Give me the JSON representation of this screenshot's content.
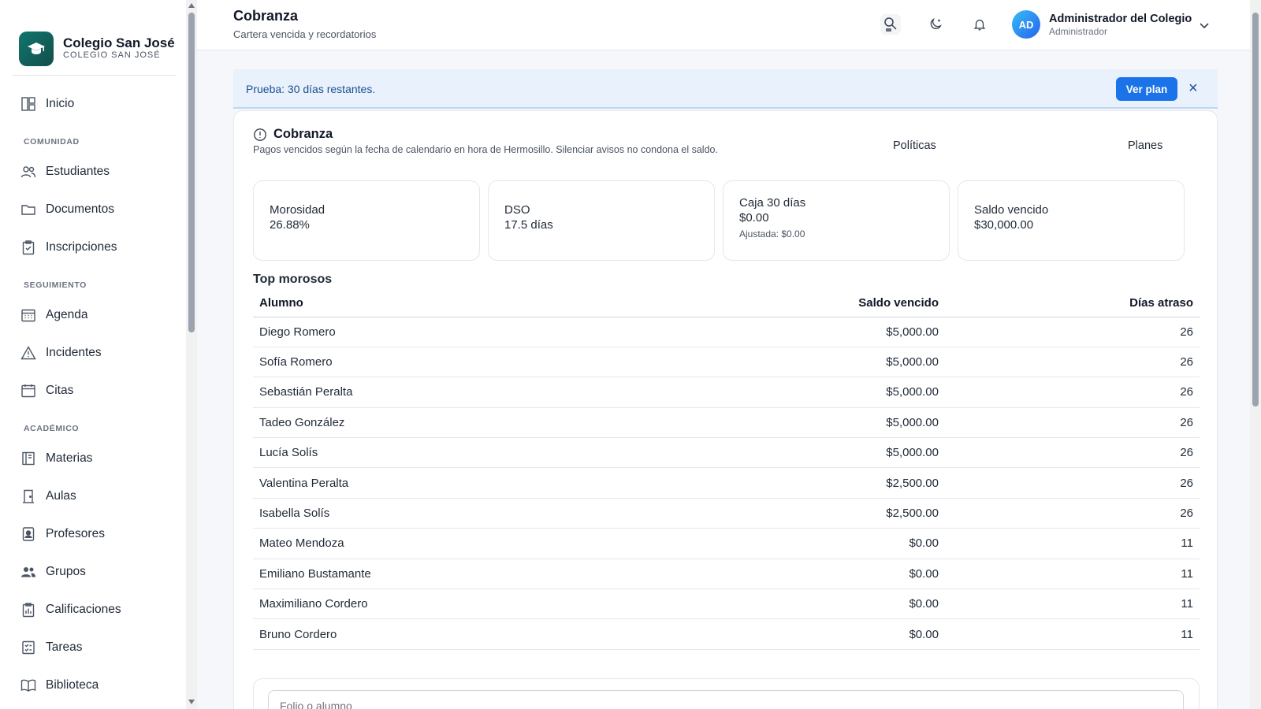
{
  "brand": {
    "title": "Colegio San José",
    "subtitle": "COLEGIO SAN JOSÉ"
  },
  "sidebar": {
    "home": "Inicio",
    "sections": [
      "COMUNIDAD",
      "SEGUIMIENTO",
      "ACADÉMICO"
    ],
    "comunidad": [
      "Estudiantes",
      "Documentos",
      "Inscripciones"
    ],
    "seguimiento": [
      "Agenda",
      "Incidentes",
      "Citas"
    ],
    "academico": [
      "Materias",
      "Aulas",
      "Profesores",
      "Grupos",
      "Calificaciones",
      "Tareas",
      "Biblioteca"
    ]
  },
  "header": {
    "title": "Cobranza",
    "subtitle": "Cartera vencida y recordatorios",
    "avatar_initials": "AD",
    "user_name": "Administrador del Colegio",
    "user_role": "Administrador"
  },
  "banner": {
    "text": "Prueba: 30 días restantes.",
    "button": "Ver plan",
    "close": "×"
  },
  "card": {
    "title": "Cobranza",
    "subtitle": "Pagos vencidos según la fecha de calendario en hora de Hermosillo. Silenciar avisos no condona el saldo.",
    "links": [
      "Políticas",
      "Planes"
    ]
  },
  "kpis": [
    {
      "label": "Morosidad",
      "value": "26.88%"
    },
    {
      "label": "DSO",
      "value": "17.5 días"
    },
    {
      "label": "Caja 30 días",
      "value": "$0.00",
      "note": "Ajustada: $0.00"
    },
    {
      "label": "Saldo vencido",
      "value": "$30,000.00"
    }
  ],
  "top": {
    "title": "Top morosos",
    "columns": [
      "Alumno",
      "Saldo vencido",
      "Días atraso"
    ],
    "rows": [
      [
        "Diego Romero",
        "$5,000.00",
        "26"
      ],
      [
        "Sofía Romero",
        "$5,000.00",
        "26"
      ],
      [
        "Sebastián Peralta",
        "$5,000.00",
        "26"
      ],
      [
        "Tadeo González",
        "$5,000.00",
        "26"
      ],
      [
        "Lucía Solís",
        "$5,000.00",
        "26"
      ],
      [
        "Valentina Peralta",
        "$2,500.00",
        "26"
      ],
      [
        "Isabella Solís",
        "$2,500.00",
        "26"
      ],
      [
        "Mateo Mendoza",
        "$0.00",
        "11"
      ],
      [
        "Emiliano Bustamante",
        "$0.00",
        "11"
      ],
      [
        "Maximiliano Cordero",
        "$0.00",
        "11"
      ],
      [
        "Bruno Cordero",
        "$0.00",
        "11"
      ]
    ]
  },
  "search": {
    "placeholder": "Folio o alumno"
  },
  "icons": {
    "home": "layout-icon",
    "students": "users-icon",
    "documents": "folder-icon",
    "enroll": "clipboard-icon",
    "agenda": "calendar-grid-icon",
    "incidents": "warning-icon",
    "appointments": "calendar-icon",
    "subjects": "book-icon",
    "rooms": "door-icon",
    "teachers": "id-badge-icon",
    "groups": "group-icon",
    "grades": "chart-clipboard-icon",
    "tasks": "checklist-icon",
    "library": "open-book-icon"
  },
  "colors": {
    "accent": "#1a73e8",
    "brand": "#0f766e",
    "banner_bg": "#e8f1fc"
  }
}
